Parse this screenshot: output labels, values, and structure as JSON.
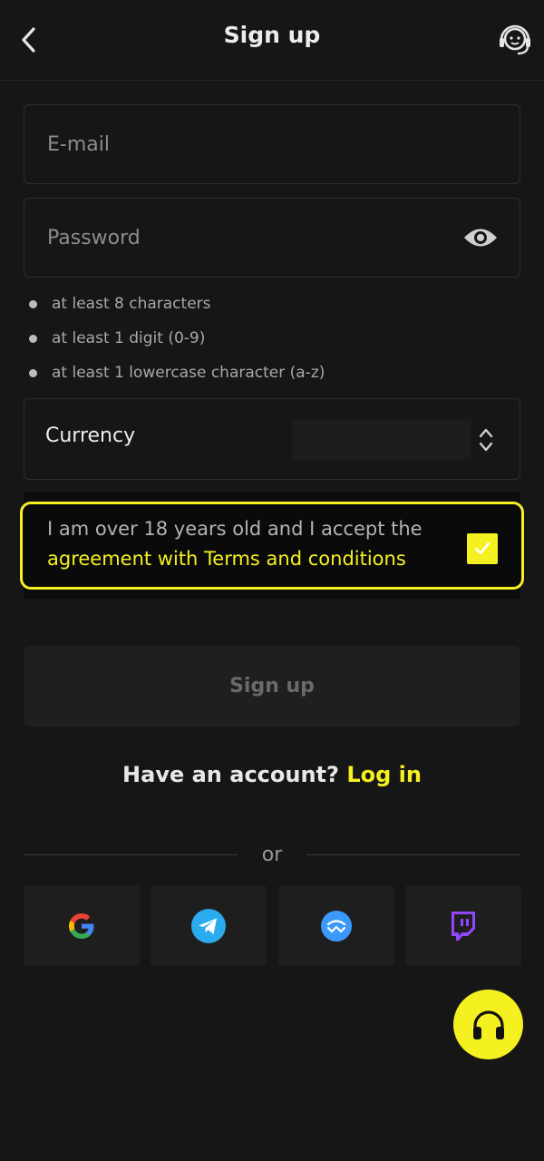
{
  "header": {
    "title": "Sign up",
    "back_icon": "chevron-left-icon",
    "support_icon": "headset-agent-icon"
  },
  "form": {
    "email_placeholder": "E-mail",
    "password_placeholder": "Password",
    "password_toggle_icon": "eye-icon",
    "password_rules": [
      "at least 8 characters",
      "at least 1 digit (0-9)",
      "at least 1 lowercase character (a-z)"
    ],
    "currency_label": "Currency",
    "currency_value": "",
    "terms_text": "I am over 18 years old and I accept the",
    "terms_link": "agreement with Terms and conditions",
    "terms_checked": true,
    "signup_label": "Sign up"
  },
  "login": {
    "prompt": "Have an account?",
    "link": "Log in"
  },
  "divider": "or",
  "social": [
    "google-icon",
    "telegram-icon",
    "walletconnect-icon",
    "twitch-icon"
  ],
  "fab_icon": "headphones-icon",
  "colors": {
    "background": "#161616",
    "accent": "#f5f020",
    "field_border": "#2d2d2d"
  }
}
